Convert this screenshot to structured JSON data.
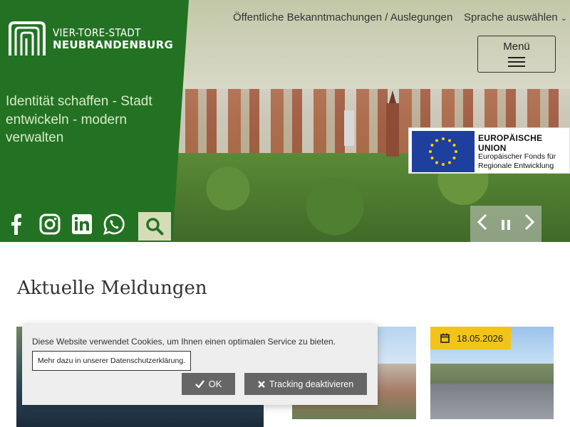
{
  "header": {
    "logo": {
      "line1": "VIER-TORE-STADT",
      "line2": "NEUBRANDENBURG"
    },
    "tagline": "Identität schaffen - Stadt entwickeln - modern verwalten",
    "top_links": {
      "notices": "Öffentliche Bekanntmachungen / Auslegungen",
      "language": "Sprache auswählen"
    },
    "menu_label": "Menü",
    "social_icons": [
      "facebook-icon",
      "instagram-icon",
      "linkedin-icon",
      "whatsapp-icon"
    ]
  },
  "eu_badge": {
    "title": "EUROPÄISCHE UNION",
    "subtitle_line1": "Europäischer Fonds für",
    "subtitle_line2": "Regionale Entwicklung"
  },
  "main": {
    "section_title": "Aktuelle Meldungen",
    "news_date": "18.05.2026"
  },
  "cookie_banner": {
    "text": "Diese Website verwendet Cookies, um Ihnen einen optimalen Service zu bieten.",
    "more_link": "Mehr dazu in unserer Datenschutzerklärung.",
    "ok_label": "OK",
    "tracking_label": "Tracking deaktivieren"
  },
  "colors": {
    "brand_green": "#237223",
    "accent_yellow": "#f2c41a",
    "search_bg": "#d6dcb8",
    "eu_blue": "#1f3f9e",
    "eu_star": "#ffd400"
  }
}
